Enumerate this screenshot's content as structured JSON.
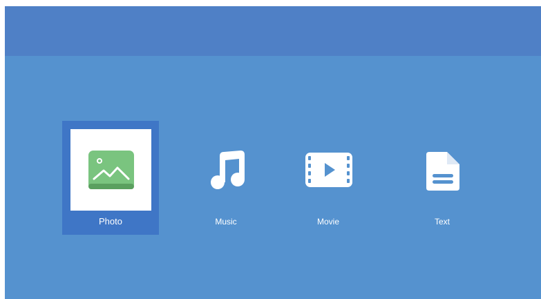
{
  "menu": {
    "items": [
      {
        "label": "Photo",
        "icon": "photo-icon",
        "selected": true
      },
      {
        "label": "Music",
        "icon": "music-icon",
        "selected": false
      },
      {
        "label": "Movie",
        "icon": "movie-icon",
        "selected": false
      },
      {
        "label": "Text",
        "icon": "text-icon",
        "selected": false
      }
    ]
  },
  "colors": {
    "background": "#5592cf",
    "top_bar": "#4f80c6",
    "selected_tile": "#3f76c6",
    "photo_icon_green": "#7ac47f",
    "icon_white": "#ffffff"
  }
}
